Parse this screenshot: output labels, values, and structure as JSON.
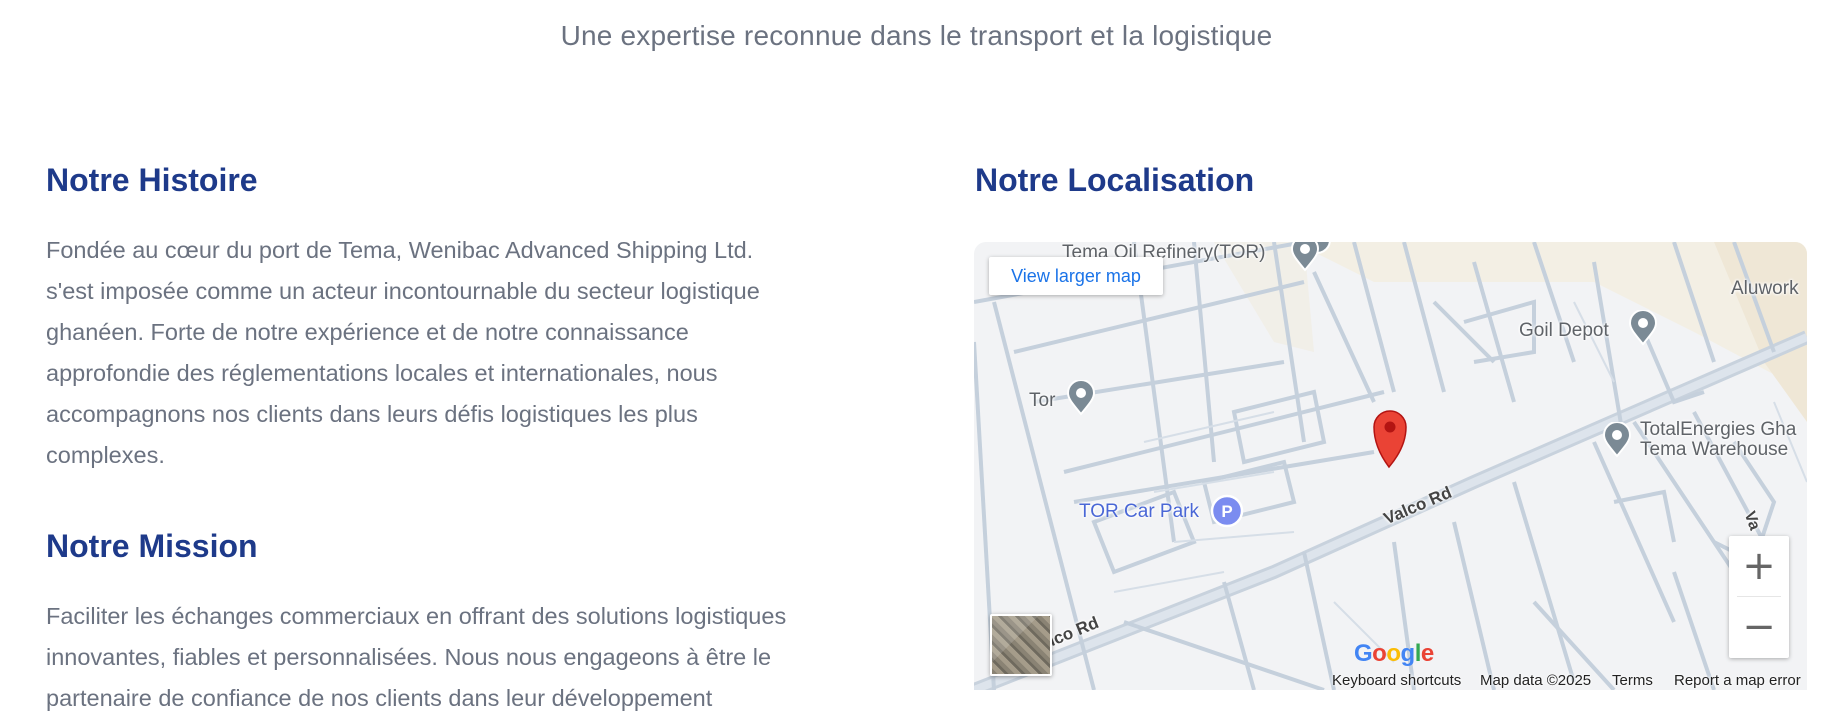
{
  "page": {
    "subtitle": "Une expertise reconnue dans le transport et la logistique"
  },
  "history": {
    "title": "Notre Histoire",
    "lines": [
      "Fondée au cœur du port de Tema, Wenibac Advanced Shipping Ltd.",
      "s'est imposée comme un acteur incontournable du secteur logistique",
      "ghanéen. Forte de notre expérience et de notre connaissance",
      "approfondie des réglementations locales et internationales, nous",
      "accompagnons nos clients dans leurs défis logistiques les plus",
      "complexes."
    ]
  },
  "mission": {
    "title": "Notre Mission",
    "lines": [
      "Faciliter les échanges commerciaux en offrant des solutions logistiques",
      "innovantes, fiables et personnalisées. Nous nous engageons à être le",
      "partenaire de confiance de nos clients dans leur développement"
    ]
  },
  "location": {
    "title": "Notre Localisation",
    "map": {
      "view_larger": "View larger map",
      "places": {
        "tema_oil": "Tema Oil Refinery(TOR)",
        "aluworks": "Aluwork",
        "goil": "Goil Depot",
        "tor": "Tor",
        "total_1": "TotalEnergies Gha",
        "total_2": "Tema Warehouse",
        "car_park": "TOR Car Park",
        "valco_1": "Valco Rd",
        "valco_2": "lco Rd",
        "va": "Va"
      },
      "parking_symbol": "P",
      "zoom_in": "+",
      "zoom_out": "−",
      "google": "Google",
      "attribution": {
        "shortcuts": "Keyboard shortcuts",
        "data": "Map data ©2025",
        "terms": "Terms",
        "report": "Report a map error"
      },
      "colors": {
        "marker": "#ea4335",
        "poi": "#7b8a95",
        "parking": "#7b8cf0",
        "road": "#c5d0dc"
      }
    }
  }
}
